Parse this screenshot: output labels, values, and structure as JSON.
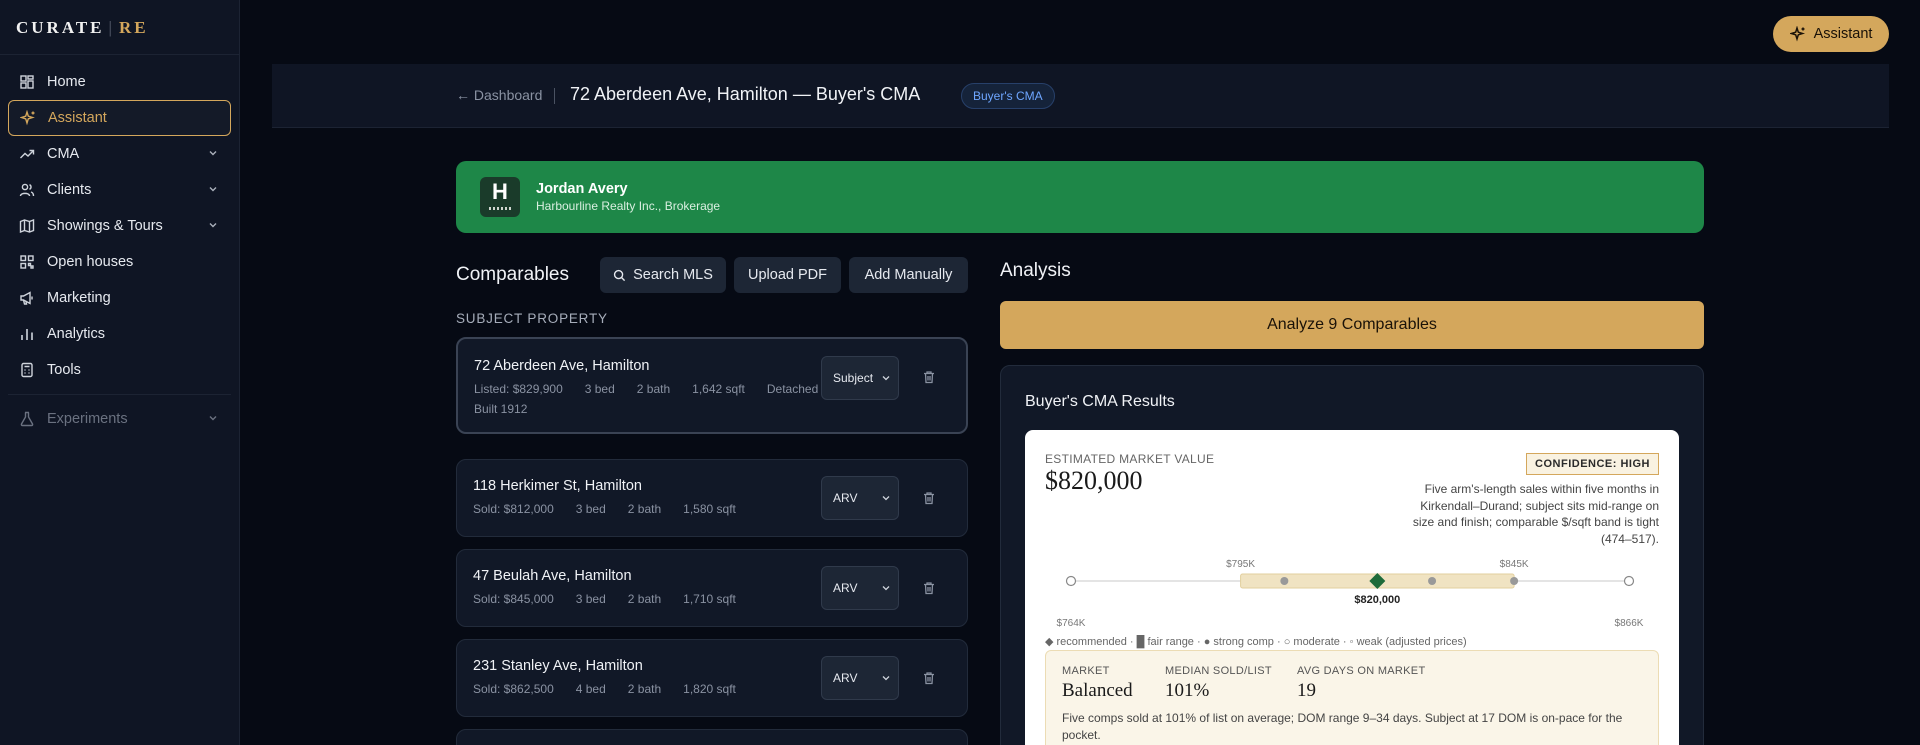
{
  "brand": {
    "name": "CURATE",
    "separator": "|",
    "suffix": "RE"
  },
  "sidebar": {
    "items": [
      {
        "label": "Home",
        "icon": "grid-icon"
      },
      {
        "label": "Assistant",
        "icon": "sparkle-icon",
        "active": true
      },
      {
        "label": "CMA",
        "icon": "trend-icon",
        "expandable": true
      },
      {
        "label": "Clients",
        "icon": "users-icon",
        "expandable": true
      },
      {
        "label": "Showings & Tours",
        "icon": "map-icon",
        "expandable": true
      },
      {
        "label": "Open houses",
        "icon": "qr-icon"
      },
      {
        "label": "Marketing",
        "icon": "megaphone-icon"
      },
      {
        "label": "Analytics",
        "icon": "bar-chart-icon"
      },
      {
        "label": "Tools",
        "icon": "calculator-icon"
      }
    ],
    "experiments": {
      "label": "Experiments",
      "icon": "flask-icon"
    }
  },
  "top_assistant": {
    "label": "Assistant"
  },
  "header": {
    "back_label": "← Dashboard",
    "title": "72 Aberdeen Ave, Hamilton — Buyer's CMA",
    "badge": "Buyer's CMA"
  },
  "agent": {
    "logo_letter": "H",
    "name": "Jordan Avery",
    "brokerage": "Harbourline Realty Inc., Brokerage"
  },
  "comparables": {
    "title": "Comparables",
    "buttons": {
      "search": "Search MLS",
      "upload": "Upload PDF",
      "manual": "Add Manually"
    },
    "subject_label": "SUBJECT PROPERTY",
    "subject": {
      "address": "72 Aberdeen Ave, Hamilton",
      "price": "Listed: $829,900",
      "beds": "3 bed",
      "baths": "2 bath",
      "sqft": "1,642 sqft",
      "type": "Detached",
      "built": "Built 1912",
      "role": "Subject"
    },
    "list": [
      {
        "address": "118 Herkimer St, Hamilton",
        "price": "Sold: $812,000",
        "beds": "3 bed",
        "baths": "2 bath",
        "sqft": "1,580 sqft",
        "role": "ARV"
      },
      {
        "address": "47 Beulah Ave, Hamilton",
        "price": "Sold: $845,000",
        "beds": "3 bed",
        "baths": "2 bath",
        "sqft": "1,710 sqft",
        "role": "ARV"
      },
      {
        "address": "231 Stanley Ave, Hamilton",
        "price": "Sold: $862,500",
        "beds": "4 bed",
        "baths": "2 bath",
        "sqft": "1,820 sqft",
        "role": "ARV"
      }
    ]
  },
  "analysis": {
    "title": "Analysis",
    "analyze_button": "Analyze 9 Comparables",
    "results_title": "Buyer's CMA Results",
    "emv_label": "ESTIMATED MARKET VALUE",
    "emv_value": "$820,000",
    "confidence": "CONFIDENCE: HIGH",
    "rationale": "Five arm's-length sales within five months in Kirkendall–Durand; subject sits mid-range on size and finish; comparable $/sqft band is tight (474–517).",
    "range": {
      "min_label": "$764K",
      "max_label": "$866K",
      "fair_low_label": "$795K",
      "fair_high_label": "$845K",
      "recommended_label": "$820,000",
      "min": 764,
      "max": 866,
      "fair_low": 795,
      "fair_high": 845,
      "recommended": 820,
      "points": [
        {
          "value": 764,
          "kind": "weak"
        },
        {
          "value": 803,
          "kind": "strong"
        },
        {
          "value": 830,
          "kind": "strong"
        },
        {
          "value": 845,
          "kind": "strong"
        },
        {
          "value": 866,
          "kind": "weak"
        }
      ]
    },
    "legend": "◆ recommended · █ fair range · ● strong comp · ○ moderate · ◦ weak (adjusted prices)",
    "market": {
      "market_label": "MARKET",
      "market_value": "Balanced",
      "ratio_label": "MEDIAN SOLD/LIST",
      "ratio_value": "101%",
      "dom_label": "AVG DAYS ON MARKET",
      "dom_value": "19",
      "note": "Five comps sold at 101% of list on average; DOM range 9–34 days. Subject at 17 DOM is on-pace for the pocket."
    }
  },
  "colors": {
    "accent": "#d4a75c",
    "banner": "#1e8748",
    "badge_text": "#6ea6ff",
    "recommended": "#1e6b3a"
  }
}
